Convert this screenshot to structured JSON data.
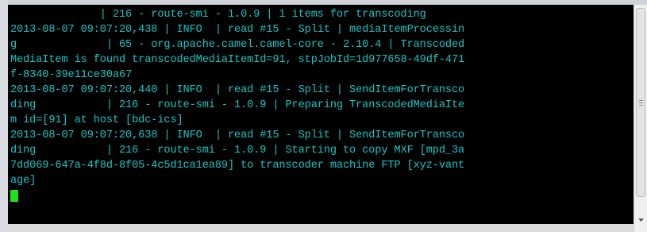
{
  "terminal": {
    "lines": [
      "              | 216 - route-smi - 1.0.9 | 1 items for transcoding",
      "2013-08-07 09:07:20,438 | INFO  | read #15 - Split | mediaItemProcessin",
      "g              | 65 - org.apache.camel.camel-core - 2.10.4 | Transcoded",
      "MediaItem is found transcodedMediaItemId=91, stpJobId=1d977658-49df-471",
      "f-8340-39e11ce30a67",
      "2013-08-07 09:07:20,440 | INFO  | read #15 - Split | SendItemForTransco",
      "ding           | 216 - route-smi - 1.0.9 | Preparing TranscodedMediaIte",
      "m id=[91] at host [bdc-ics]",
      "2013-08-07 09:07:20,638 | INFO  | read #15 - Split | SendItemForTransco",
      "ding           | 216 - route-smi - 1.0.9 | Starting to copy MXF [mpd_3a",
      "7dd069-647a-4f8d-8f05-4c5d1ca1ea89] to transcoder machine FTP [xyz-vant",
      "age]"
    ],
    "text_color": "#19c4c4",
    "background": "#000000",
    "cursor_color": "#20e020"
  },
  "scrollbar": {
    "down_arrow_icon": "chevron-down-icon"
  }
}
